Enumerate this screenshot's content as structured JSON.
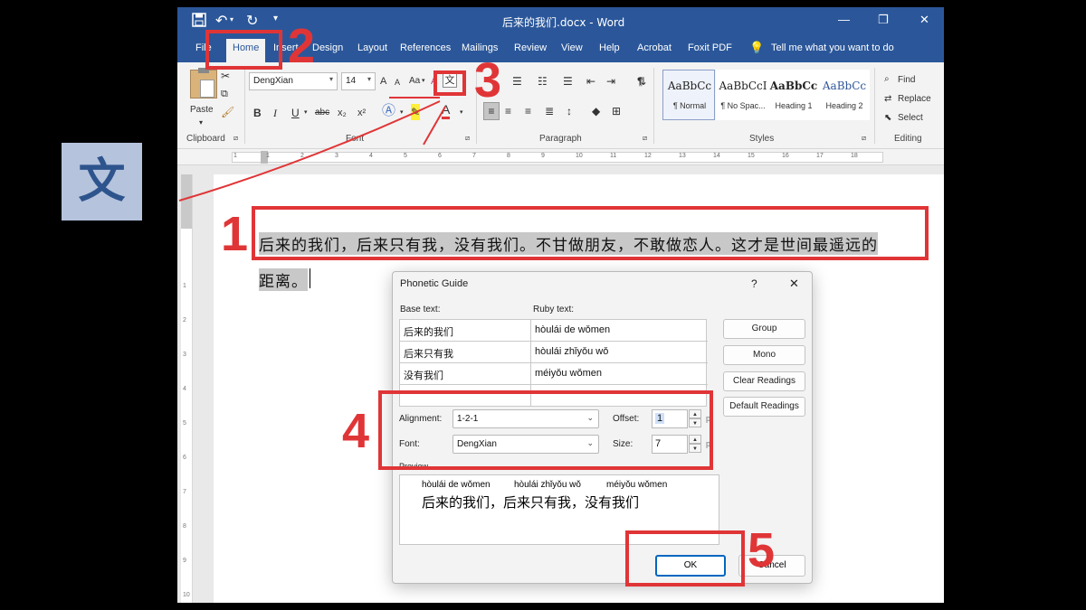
{
  "left_tile": {
    "glyph": "文"
  },
  "window": {
    "title": "后来的我们.docx  -  Word",
    "controls": {
      "minimize": "—",
      "maximize": "❐",
      "close": "✕"
    }
  },
  "quick_access": {
    "save": "save-icon",
    "undo": "↶",
    "redo": "↻",
    "more": "▾"
  },
  "tabs": [
    {
      "label": "File"
    },
    {
      "label": "Home"
    },
    {
      "label": "Insert"
    },
    {
      "label": "Design"
    },
    {
      "label": "Layout"
    },
    {
      "label": "References"
    },
    {
      "label": "Mailings"
    },
    {
      "label": "Review"
    },
    {
      "label": "View"
    },
    {
      "label": "Help"
    },
    {
      "label": "Acrobat"
    },
    {
      "label": "Foxit PDF"
    }
  ],
  "tell_me": "Tell me what you want to do",
  "ribbon": {
    "clipboard": {
      "paste_label": "Paste",
      "group_label": "Clipboard"
    },
    "font": {
      "name": "DengXian",
      "size": "14",
      "group_label": "Font",
      "buttons": {
        "bold": "B",
        "italic": "I",
        "underline": "U",
        "strike": "abc",
        "sub": "x₂",
        "sup": "x²",
        "grow": "A",
        "shrink": "A",
        "case": "Aa",
        "color": "A"
      }
    },
    "paragraph": {
      "group_label": "Paragraph",
      "pilcrow": "¶"
    },
    "styles": {
      "group_label": "Styles",
      "items": [
        {
          "sample": "AaBbCc",
          "name": "¶ Normal"
        },
        {
          "sample": "AaBbCcI",
          "name": "¶ No Spac..."
        },
        {
          "sample": "AaBbCc",
          "name": "Heading 1"
        },
        {
          "sample": "AaBbCc",
          "name": "Heading 2"
        }
      ]
    },
    "editing": {
      "group_label": "Editing",
      "find": "Find",
      "replace": "Replace",
      "select": "Select"
    }
  },
  "ruler_numbers": [
    "1",
    "1",
    "2",
    "3",
    "4",
    "5",
    "6",
    "7",
    "8",
    "9",
    "10",
    "11",
    "12",
    "13",
    "14",
    "15",
    "16",
    "17",
    "18"
  ],
  "vruler_numbers": [
    "1",
    "2",
    "3",
    "4",
    "5",
    "6",
    "7",
    "8",
    "9",
    "10"
  ],
  "document": {
    "line1": "后来的我们，后来只有我，没有我们。不甘做朋友，不敢做恋人。这才是世间最遥远的",
    "line2": "距离。"
  },
  "dialog": {
    "title": "Phonetic Guide",
    "help": "?",
    "close": "✕",
    "base_header": "Base text:",
    "ruby_header": "Ruby text:",
    "rows": [
      {
        "base": "后来的我们",
        "ruby": "hòulái de wǒmen"
      },
      {
        "base": "后来只有我",
        "ruby": "hòulái zhǐyǒu wǒ"
      },
      {
        "base": "没有我们",
        "ruby": "méiyǒu wǒmen"
      },
      {
        "base": "",
        "ruby": ""
      }
    ],
    "alignment_label": "Alignment:",
    "alignment_value": "1-2-1",
    "offset_label": "Offset:",
    "offset_value": "1",
    "font_label": "Font:",
    "font_value": "DengXian",
    "size_label": "Size:",
    "size_value": "7",
    "pt": "pt",
    "preview_label": "Preview",
    "preview_ruby": [
      "hòulái  de  wǒmen",
      "hòulái  zhǐyǒu  wǒ",
      "méiyǒu  wǒmen"
    ],
    "preview_base": "后来的我们，后来只有我，没有我们",
    "buttons": {
      "group": "Group",
      "mono": "Mono",
      "clear": "Clear Readings",
      "default": "Default Readings",
      "ok": "OK",
      "cancel": "Cancel"
    }
  },
  "annotations": {
    "n1": "1",
    "n2": "2",
    "n3": "3",
    "n4": "4",
    "n5": "5",
    "color": "#e03537"
  },
  "colors": {
    "word_blue": "#2b579a",
    "annotation_red": "#e03537"
  }
}
